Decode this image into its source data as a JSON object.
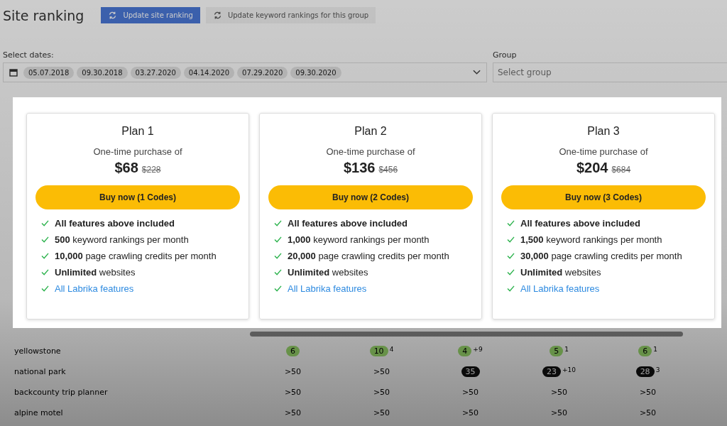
{
  "page": {
    "title": "Site ranking",
    "buttons": [
      {
        "label": "Update site ranking",
        "disabled": false
      },
      {
        "label": "Update keyword rankings for this group",
        "disabled": true
      }
    ]
  },
  "dates": {
    "label": "Select dates:",
    "chips": [
      "05.07.2018",
      "09.30.2018",
      "03.27.2020",
      "04.14.2020",
      "07.29.2020",
      "09.30.2020"
    ]
  },
  "group": {
    "label": "Group",
    "placeholder": "Select group"
  },
  "table": {
    "rows": [
      {
        "keyword": "yellowstone",
        "cells": [
          {
            "value": "6",
            "kind": "top"
          },
          {
            "value": "10",
            "kind": "top",
            "change": "4"
          },
          {
            "value": "4",
            "kind": "top",
            "change": "+9"
          },
          {
            "value": "5",
            "kind": "top",
            "change": "1"
          },
          {
            "value": "6",
            "kind": "top",
            "change": "1"
          }
        ]
      },
      {
        "keyword": "national park",
        "cells": [
          {
            "value": ">50",
            "kind": "none"
          },
          {
            "value": ">50",
            "kind": "none"
          },
          {
            "value": "35",
            "kind": "ranked"
          },
          {
            "value": "23",
            "kind": "ranked",
            "change": "+10"
          },
          {
            "value": "28",
            "kind": "ranked",
            "change": "3"
          }
        ]
      },
      {
        "keyword": "backcounty trip planner",
        "cells": [
          {
            "value": ">50",
            "kind": "none"
          },
          {
            "value": ">50",
            "kind": "none"
          },
          {
            "value": ">50",
            "kind": "none"
          },
          {
            "value": ">50",
            "kind": "none"
          },
          {
            "value": ">50",
            "kind": "none"
          }
        ]
      },
      {
        "keyword": "alpine motel",
        "cells": [
          {
            "value": ">50",
            "kind": "none"
          },
          {
            "value": ">50",
            "kind": "none"
          },
          {
            "value": ">50",
            "kind": "none"
          },
          {
            "value": ">50",
            "kind": "none"
          },
          {
            "value": ">50",
            "kind": "none"
          }
        ]
      }
    ]
  },
  "plans": [
    {
      "name": "Plan 1",
      "subtitle": "One-time purchase of",
      "price": "$68",
      "old_price": "$228",
      "button": "Buy now (1 Codes)",
      "features": [
        {
          "text": "**All features above included**",
          "kind": "text"
        },
        {
          "text": "**500** keyword rankings per month",
          "kind": "text"
        },
        {
          "text": "**10,000** page crawling credits per month",
          "kind": "text"
        },
        {
          "text": "**Unlimited** websites",
          "kind": "text"
        },
        {
          "text": "All Labrika features",
          "kind": "link"
        }
      ]
    },
    {
      "name": "Plan 2",
      "subtitle": "One-time purchase of",
      "price": "$136",
      "old_price": "$456",
      "button": "Buy now (2 Codes)",
      "features": [
        {
          "text": "**All features above included**",
          "kind": "text"
        },
        {
          "text": "**1,000** keyword rankings per month",
          "kind": "text"
        },
        {
          "text": "**20,000** page crawling credits per month",
          "kind": "text"
        },
        {
          "text": "**Unlimited** websites",
          "kind": "text"
        },
        {
          "text": "All Labrika features",
          "kind": "link"
        }
      ]
    },
    {
      "name": "Plan 3",
      "subtitle": "One-time purchase of",
      "price": "$204",
      "old_price": "$684",
      "button": "Buy now (3 Codes)",
      "features": [
        {
          "text": "**All features above included**",
          "kind": "text"
        },
        {
          "text": "**1,500** keyword rankings per month",
          "kind": "text"
        },
        {
          "text": "**30,000** page crawling credits per month",
          "kind": "text"
        },
        {
          "text": "**Unlimited** websites",
          "kind": "text"
        },
        {
          "text": "All Labrika features",
          "kind": "link"
        }
      ]
    }
  ]
}
